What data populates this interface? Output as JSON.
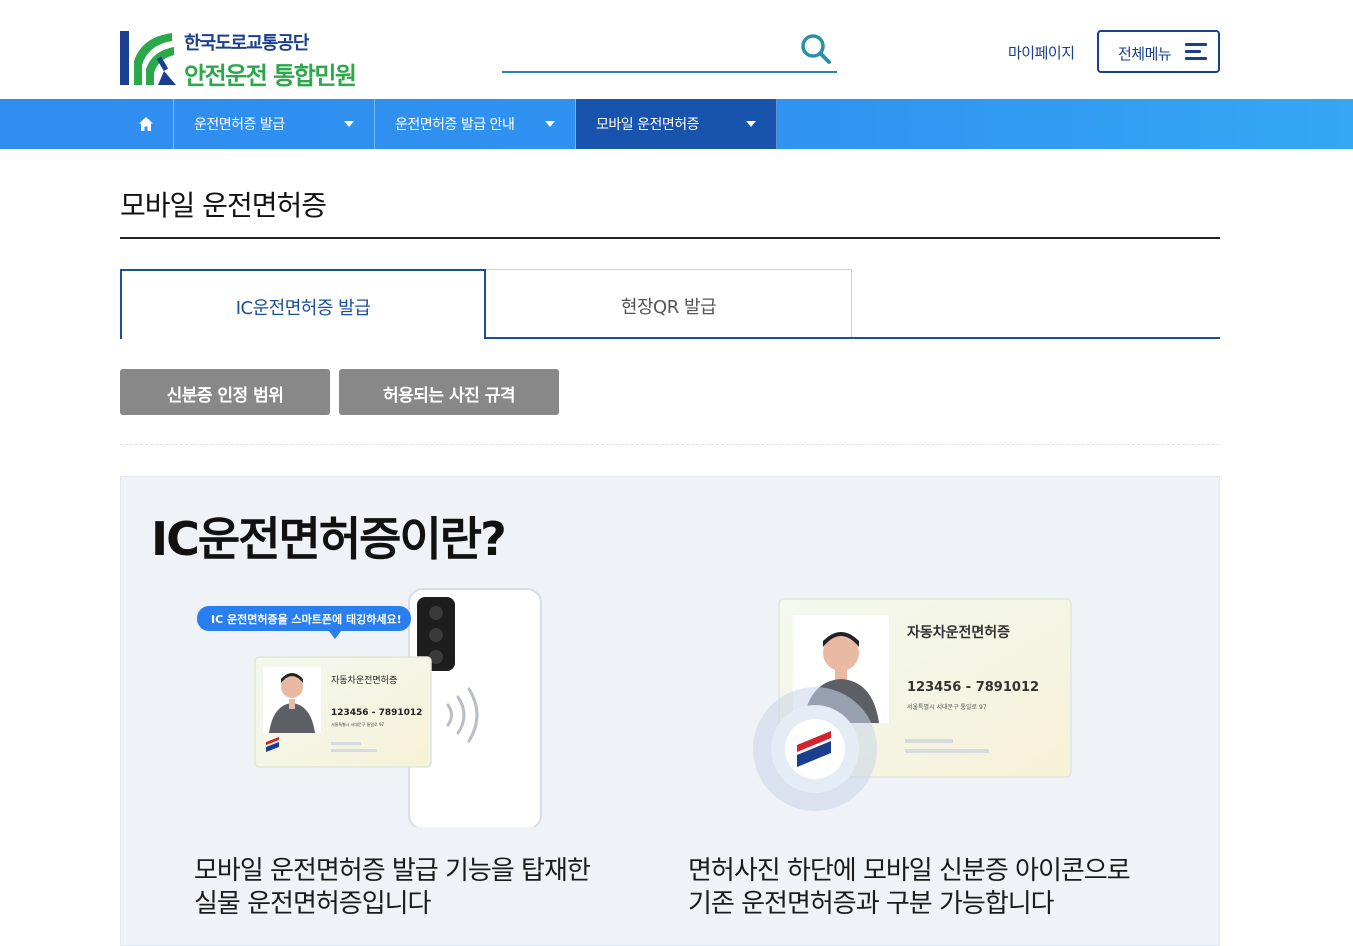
{
  "header": {
    "logo_sub": "한국도로교통공단",
    "logo_main": "안전운전 통합민원",
    "search_placeholder": "",
    "mypage_label": "마이페이지",
    "allmenu_label": "전체메뉴"
  },
  "nav": {
    "items": [
      {
        "label": "운전면허증 발급"
      },
      {
        "label": "운전면허증 발급 안내"
      },
      {
        "label": "모바일 운전면허증"
      }
    ]
  },
  "page": {
    "title": "모바일 운전면허증",
    "tabs": [
      {
        "label": "IC운전면허증 발급"
      },
      {
        "label": "현장QR 발급"
      }
    ],
    "sub_buttons": [
      {
        "label": "신분증 인정 범위"
      },
      {
        "label": "허용되는 사진 규격"
      }
    ]
  },
  "panel": {
    "heading": "IC운전면허증이란?",
    "left": {
      "bubble": "IC 운전면허증을 스마트폰에 태깅하세요!",
      "card_title": "자동차운전면허증",
      "card_number": "123456 - 7891012",
      "card_address": "서울특별시 서대문구 통일로 97",
      "caption_line1": "모바일 운전면허증 발급 기능을 탑재한",
      "caption_line2": "실물 운전면허증입니다"
    },
    "right": {
      "card_title": "자동차운전면허증",
      "card_number": "123456 - 7891012",
      "card_address": "서울특별시 서대문구 통일로 97",
      "caption_line1": "면허사진 하단에 모바일 신분증 아이콘으로",
      "caption_line2": "기존 운전면허증과 구분 가능합니다"
    }
  },
  "colors": {
    "brand_navy": "#1a3f8f",
    "brand_green": "#2aa84a",
    "nav_blue": "#2f8df0",
    "nav_active": "#1853ad",
    "tab_active": "#1a4f9c",
    "sub_button_gray": "#888888"
  },
  "icons": [
    "logo-k-icon",
    "search-icon",
    "hamburger-icon",
    "home-icon",
    "chevron-down-icon",
    "nfc-waves-icon",
    "mobile-id-icon"
  ]
}
